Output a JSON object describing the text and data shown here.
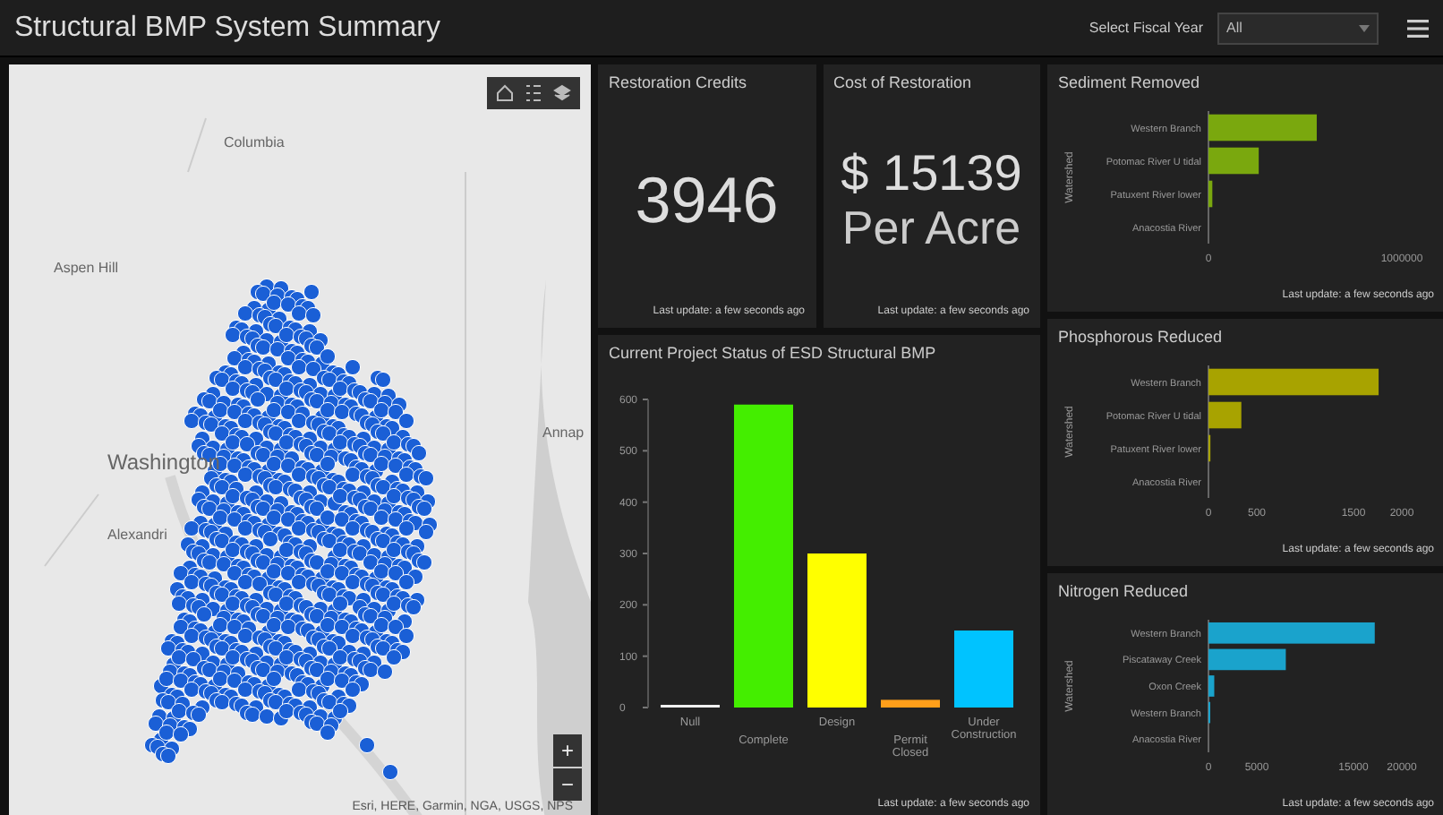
{
  "header": {
    "title": "Structural BMP System Summary",
    "fiscal_year_label": "Select Fiscal Year",
    "fiscal_year_value": "All"
  },
  "map": {
    "places": [
      {
        "label": "Columbia"
      },
      {
        "label": "Aspen Hill"
      },
      {
        "label": "Washington"
      },
      {
        "label": "Alexandri"
      },
      {
        "label": "Annap"
      }
    ],
    "attribution": "Esri, HERE, Garmin, NGA, USGS, NPS",
    "zoom_in": "+",
    "zoom_out": "−"
  },
  "indicators": [
    {
      "title": "Restoration Credits",
      "value": "3946",
      "footer": "Last update: a few seconds ago"
    },
    {
      "title": "Cost of Restoration",
      "value": "$ 15139",
      "unit": "Per Acre",
      "footer": "Last update: a few seconds ago"
    }
  ],
  "status_chart": {
    "title": "Current Project Status of ESD Structural BMP",
    "footer": "Last update: a few seconds ago",
    "chart_data": {
      "type": "bar",
      "categories": [
        "Null",
        "Complete",
        "Design",
        "Permit Closed",
        "Under Construction"
      ],
      "series": [
        {
          "color": "#f0f0f0",
          "values": [
            5,
            null,
            null,
            null,
            null
          ]
        },
        {
          "color": "#44ee00",
          "values": [
            null,
            590,
            null,
            null,
            null
          ]
        },
        {
          "color": "#ffff00",
          "values": [
            null,
            null,
            300,
            null,
            null
          ]
        },
        {
          "color": "#ff9f1a",
          "values": [
            null,
            null,
            null,
            15,
            null
          ]
        },
        {
          "color": "#00c3ff",
          "values": [
            null,
            null,
            null,
            null,
            150
          ]
        }
      ],
      "ylim": [
        0,
        600
      ],
      "yticks": [
        0,
        100,
        200,
        300,
        400,
        500,
        600
      ]
    }
  },
  "side_charts": [
    {
      "title": "Sediment Removed",
      "footer": "Last update: a few seconds ago",
      "chart_data": {
        "type": "bar",
        "orientation": "horizontal",
        "ylabel": "Watershed",
        "categories": [
          "Western Branch",
          "Potomac River U tidal",
          "Patuxent River lower",
          "Anacostia River"
        ],
        "series": [
          {
            "color": "#7aa80e",
            "values": [
              560000,
              260000,
              20000,
              0
            ]
          }
        ],
        "xlim": [
          0,
          1000000
        ],
        "xticks": [
          0,
          1000000
        ]
      }
    },
    {
      "title": "Phosphorous Reduced",
      "footer": "Last update: a few seconds ago",
      "chart_data": {
        "type": "bar",
        "orientation": "horizontal",
        "ylabel": "Watershed",
        "categories": [
          "Western Branch",
          "Potomac River U tidal",
          "Patuxent River lower",
          "Anacostia River"
        ],
        "series": [
          {
            "color": "#a8a300",
            "values": [
              1760,
              340,
              20,
              0
            ]
          }
        ],
        "xlim": [
          0,
          2000
        ],
        "xticks": [
          0,
          500,
          1500,
          2000
        ]
      }
    },
    {
      "title": "Nitrogen Reduced",
      "footer": "Last update: a few seconds ago",
      "chart_data": {
        "type": "bar",
        "orientation": "horizontal",
        "ylabel": "Watershed",
        "categories": [
          "Western Branch",
          "Piscataway Creek",
          "Oxon Creek",
          "Western Branch",
          "Anacostia River"
        ],
        "series": [
          {
            "color": "#1aa3cc",
            "values": [
              17200,
              8000,
              600,
              100,
              0
            ]
          }
        ],
        "xlim": [
          0,
          20000
        ],
        "xticks": [
          0,
          5000,
          15000,
          20000
        ]
      }
    }
  ]
}
